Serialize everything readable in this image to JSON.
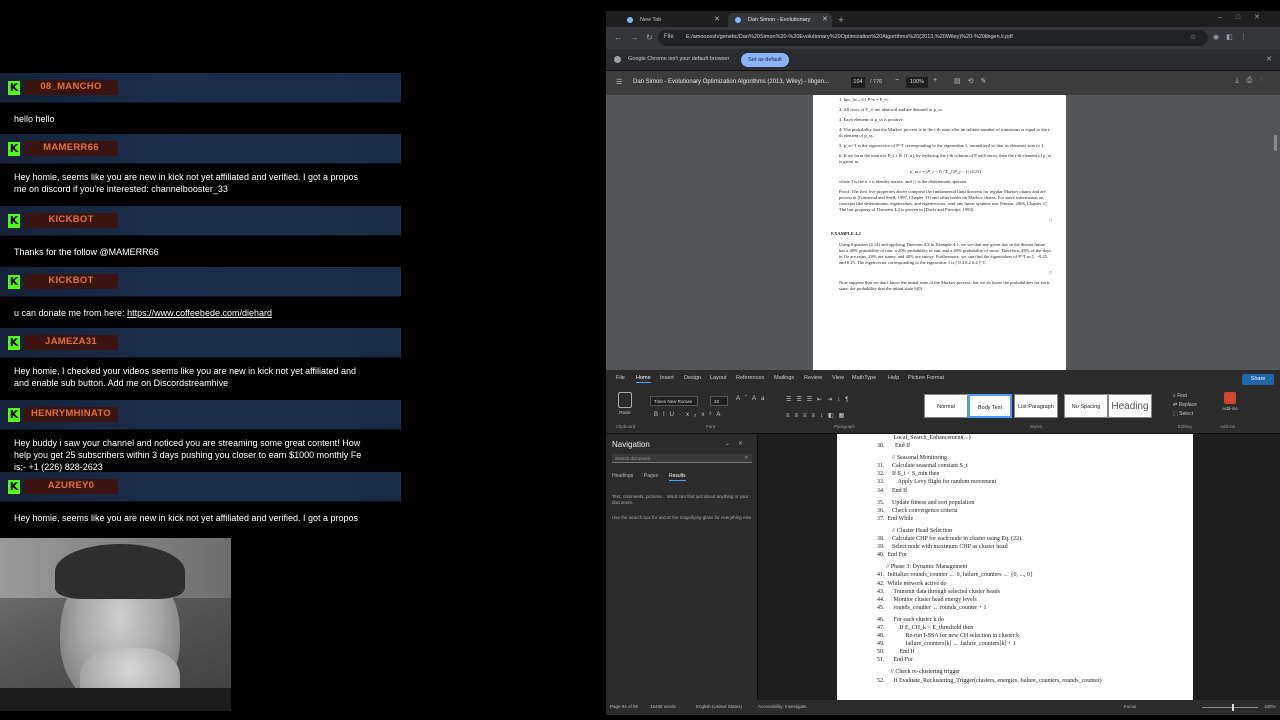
{
  "chat": {
    "messages": [
      {
        "user": "08_MANCHO",
        "lines": [
          "hello hello"
        ]
      },
      {
        "user": "MAMERR66",
        "lines": [
          "Hey homie, seems like you are new in kick not yet affiliated and verified. I got a propos",
          "me on discord if you're interested: channelbooster_33"
        ]
      },
      {
        "user": "KICKBOT",
        "lines": [
          "Thanks for the follow @MAMERR66"
        ]
      },
      {
        "user": "KICKBOT",
        "prefix": "u can donate me from here: ",
        "link": "https://www.coffeebede.com/diehard"
      },
      {
        "user": "JAMEZA31",
        "lines": [
          "Hey homie, I checked your videos seems like you are new in kick not yet affiliated and",
          "and enable sub button. Add me on Discordstreamhive"
        ]
      },
      {
        "user": "HENRYMHINATO",
        "lines": [
          "Hey buddy i saw your channel and noticed you are streaming some great content! How",
          "help you get 25 subscribers within 3 days pushing you closer to earn $1000 monthly Fe",
          "is;- +1 (226) 828-2623"
        ]
      },
      {
        "user": "AZUREY0",
        "lines": [
          "Hey homie, seems like you are new in kick not yet affiliated and verified. I got a propos"
        ]
      }
    ]
  },
  "browser": {
    "tabs": [
      {
        "label": "New Tab"
      },
      {
        "label": "Dan Simon - Evolutionary Optim..."
      }
    ],
    "url": "E:/amoozesh/genetic/Dan%20Simon%20-%20Evolutionary%20Optimization%20Algorithms%20(2013,%20Wiley)%20-%20libgen.li.pdf",
    "file_label": "File",
    "infobar_text": "Google Chrome isn't your default browser",
    "infobar_button": "Set as default",
    "pdf_title": "Dan Simon - Evolutionary Optimization Algorithms (2013, Wiley) - libgen...",
    "page_current": "104",
    "page_total": "/ 776",
    "zoom": "100%",
    "pdf_text": {
      "items": [
        "1.  lim_{n→∞} P^n = P_∞.",
        "2.  All rows of P_∞ are identical and are denoted as p_ss.",
        "3.  Each element of p_ss is positive.",
        "4.  The probability that the Markov process is in the i-th state after an infinite number of transitions is equal to the i-th element of p_ss.",
        "5.  p_ss^T is the eigenvector of P^T corresponding to the eigenvalue 1, normalized so that its elements sum to 1.",
        "6.  If we form the matrices P_i, i ∈ [1, n], by replacing the i-th column of P with zeros, then the i-th element of p_ss is given as"
      ],
      "equation": "p_ss,i = |P_i − I| / Σ_j |P_j − I|          (4.15)",
      "where": "where I is the n × n identity matrix, and |·| is the determinant operator.",
      "proof": "Proof: The first five properties above comprise the fundamental limit theorem for regular Markov chains and are proven in [Grinstead and Snell, 1997, Chapter 11] and other books on Markov chains. For more information on concepts like determinants, eigenvalues, and eigenvectors, read any linear systems text [Simon, 2006, Chapter 1]. The last property of Theorem 4.2 is proven in [Davis and Principe, 1993].",
      "qed": "□",
      "example_title": "EXAMPLE 4.2",
      "example_body": "Using Equation (4.14) and applying Theorem 4.2 to Example 4.1, we see that any given day in the distant future has a 40% probability of rain, a 20% probability of sun, and a 40% probability of snow. Therefore, 40% of the days in Oz are rainy, 20% are sunny, and 40% are snowy. Furthermore, we can find the eigenvalues of P^T as 1, −0.25, and 0.25. The eigenvector corresponding to the eigenvalue 1 is [ 0.4   0.2   0.4 ]^T.",
      "qed2": "□",
      "tail": "Now suppose that we don't know the initial state of the Markov process, but we do know the probabilities for each state; the probability that the initial state S(0)"
    }
  },
  "word": {
    "tabs": [
      "File",
      "Home",
      "Insert",
      "Design",
      "Layout",
      "References",
      "Mailings",
      "Review",
      "View",
      "MathType",
      "Help",
      "Picture Format"
    ],
    "active_tab": "Home",
    "share": "Share",
    "paste": "Paste",
    "font": "Times New Roman",
    "size": "10",
    "styles": [
      "Normal",
      "Body Text",
      "List Paragraph",
      "No Spacing",
      "Heading"
    ],
    "editing": [
      "Find",
      "Replace",
      "Select"
    ],
    "addins": "Add-ins",
    "group_labels": [
      "Clipboard",
      "Font",
      "Paragraph",
      "Styles",
      "Editing",
      "Add-ins"
    ],
    "nav": {
      "title": "Navigation",
      "search_placeholder": "Search document",
      "tabs": [
        "Headings",
        "Pages",
        "Results"
      ],
      "msg1": "Text, comments, pictures... Word can find just about anything in your document.",
      "msg2": "Use the search box for text or the magnifying glass for everything else."
    },
    "doc_lines": [
      "           Local_Search_Enhancement(...)",
      "30.       End If",
      "",
      "          // Seasonal Monitoring",
      "31.     Calculate seasonal constant S_t",
      "32.     If S_t < S_min then",
      "33.         Apply Levy flight for random movement",
      "34.     End If",
      "",
      "35.     Update fitness and sort population",
      "36.     Check convergence criteria",
      "37.  End While",
      "",
      "          // Cluster Head Selection",
      "38.     Calculate CHP for each node in cluster using Eq. (22).",
      "39.     Select node with maximum CHP as cluster head",
      "40.  End For",
      "",
      "      // Phase 3: Dynamic Management",
      "41.  Initialize rounds_counter ← 0, failure_counters ← {0, ..., 0}",
      "42.  While network active do",
      "43.      Transmit data through selected cluster heads",
      "44.      Monitor cluster head energy levels",
      "45.      rounds_counter ← rounds_counter + 1",
      "",
      "46.      For each cluster k do",
      "47.          If E_CH_k < E_threshold then",
      "48.              Re-run I-SSA for new CH selection in cluster k",
      "49.              failure_counters[k] ← failure_counters[k] + 1",
      "50.          End If",
      "51.      End For",
      "",
      "         // Check re-clustering trigger",
      "52.      If Evaluate_Reclustering_Trigger(clusters, energies, failure_counters, rounds_counter)"
    ],
    "status": {
      "page": "Page 84 of 96",
      "words": "15498 words",
      "lang": "English (United States)",
      "access": "Accessibility: Investigate",
      "focus": "Focus",
      "zoom": "100%"
    }
  }
}
